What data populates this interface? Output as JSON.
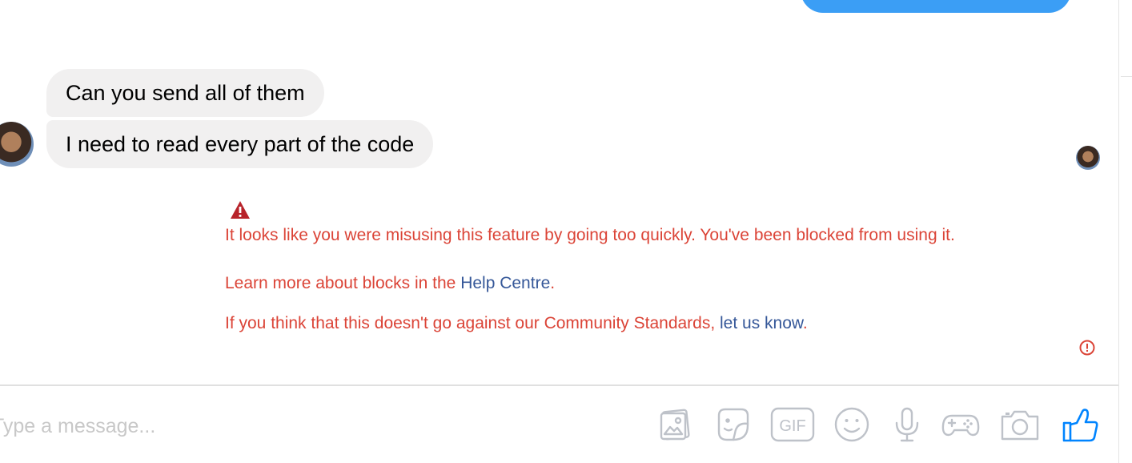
{
  "messages": [
    {
      "text": "Can you send all of them"
    },
    {
      "text": "I need to read every part of the code"
    }
  ],
  "error": {
    "line1": "It looks like you were misusing this feature by going too quickly. You've been blocked from using it.",
    "line2_prefix": "Learn more about blocks in the ",
    "line2_link": "Help Centre",
    "line2_suffix": ".",
    "line3_prefix": "If you think that this doesn't go against our Community Standards, ",
    "line3_link": "let us know",
    "line3_suffix": ".",
    "color": "#db4437",
    "link_color": "#365899"
  },
  "composer": {
    "placeholder": "Type a message...",
    "gif_label": "GIF",
    "tools": [
      "image-icon",
      "sticker-icon",
      "gif-icon",
      "emoji-icon",
      "microphone-icon",
      "game-controller-icon",
      "camera-icon",
      "thumbs-up-icon"
    ]
  },
  "colors": {
    "sent_bubble": "#3b9ef5",
    "received_bubble": "#f1f0f0",
    "toolbar_icon": "#bec2c9",
    "like_icon": "#0084ff"
  }
}
